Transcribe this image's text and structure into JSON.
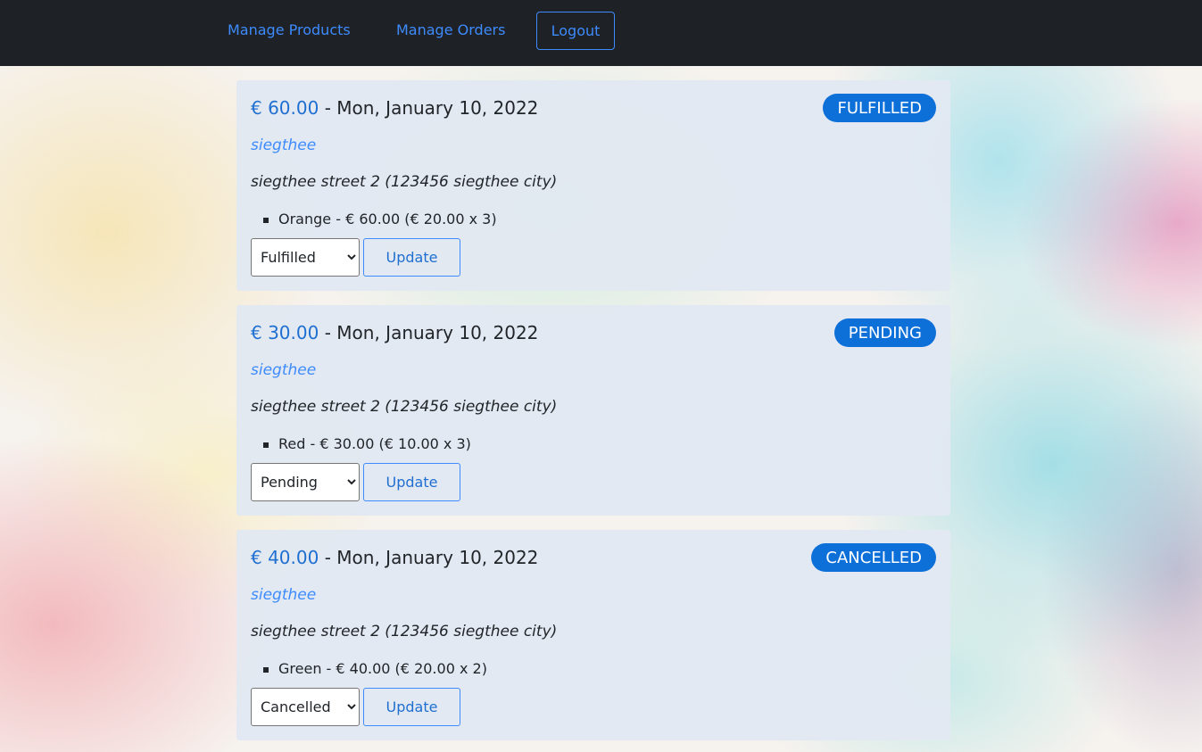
{
  "nav": {
    "manage_products": "Manage Products",
    "manage_orders": "Manage Orders",
    "logout": "Logout"
  },
  "orders": [
    {
      "price": "€ 60.00",
      "separator": " - ",
      "date": "Mon, January 10, 2022",
      "status_badge": "FULFILLED",
      "customer": "siegthee",
      "address": "siegthee street 2 (123456 siegthee city)",
      "items": [
        "Orange - € 60.00 (€ 20.00 x 3)"
      ],
      "selected_status": "Fulfilled",
      "update_label": "Update"
    },
    {
      "price": "€ 30.00",
      "separator": " - ",
      "date": "Mon, January 10, 2022",
      "status_badge": "PENDING",
      "customer": "siegthee",
      "address": "siegthee street 2 (123456 siegthee city)",
      "items": [
        "Red - € 30.00 (€ 10.00 x 3)"
      ],
      "selected_status": "Pending",
      "update_label": "Update"
    },
    {
      "price": "€ 40.00",
      "separator": " - ",
      "date": "Mon, January 10, 2022",
      "status_badge": "CANCELLED",
      "customer": "siegthee",
      "address": "siegthee street 2 (123456 siegthee city)",
      "items": [
        "Green - € 40.00 (€ 20.00 x 2)"
      ],
      "selected_status": "Cancelled",
      "update_label": "Update"
    }
  ],
  "colors": {
    "navbar_bg": "#1e2125",
    "link": "#3d8bfd",
    "badge_bg": "#0d6fd8",
    "card_bg": "#e2e8f1"
  }
}
